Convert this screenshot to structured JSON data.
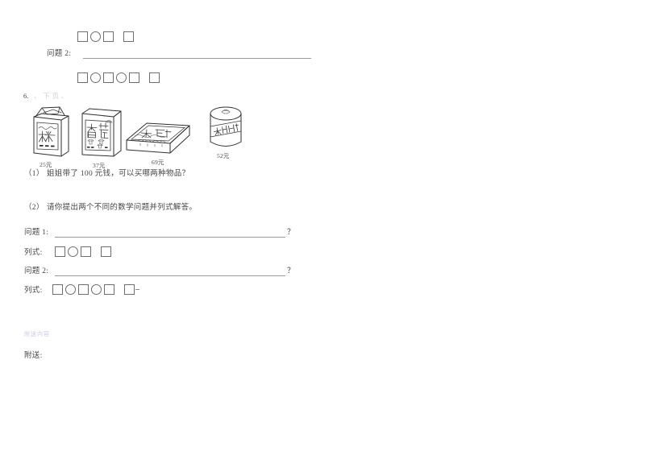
{
  "document": {
    "type": "scanned-math-worksheet",
    "language": "zh-CN",
    "page_background": "#ffffff",
    "ink_color": "#2f2f2f"
  },
  "top_section": {
    "answer_row_1": {
      "name": "列式填空行",
      "slots": [
        "square",
        "circle",
        "square",
        "gap",
        "square"
      ]
    },
    "question_2_label": "问题 2:",
    "answer_row_2": {
      "name": "列式填空行",
      "slots": [
        "square",
        "circle",
        "square",
        "circle",
        "square",
        "gap",
        "square"
      ]
    }
  },
  "problem6": {
    "number": "6.",
    "faint_note": "、 下 页 、",
    "items": [
      {
        "id": "rice",
        "label": "大米",
        "price": "25元"
      },
      {
        "id": "mushroom",
        "label": "香菇",
        "price": "37元"
      },
      {
        "id": "shrimp",
        "label": "大虾",
        "price": "69元"
      },
      {
        "id": "can",
        "label": "老北京",
        "price": "52元"
      }
    ],
    "sub_questions": [
      {
        "marker": "（1）",
        "text": "姐姐带了 100 元钱，可以买哪两种物品？"
      },
      {
        "marker": "（2）",
        "text": "请你提出两个不同的数学问题并列式解答。"
      }
    ],
    "blanks": [
      {
        "label": "问题 1:",
        "trailing": "？",
        "formula_label": "列式:",
        "slots": [
          "square",
          "circle",
          "square",
          "gap",
          "square"
        ]
      },
      {
        "label": "问题 2:",
        "trailing": "？",
        "formula_label": "列式:",
        "slots": [
          "square",
          "circle",
          "square",
          "circle",
          "square",
          "gap",
          "square",
          "tick"
        ]
      }
    ]
  },
  "footer": {
    "faint_blue_text": "附送内容",
    "attachment_label": "附送:"
  }
}
